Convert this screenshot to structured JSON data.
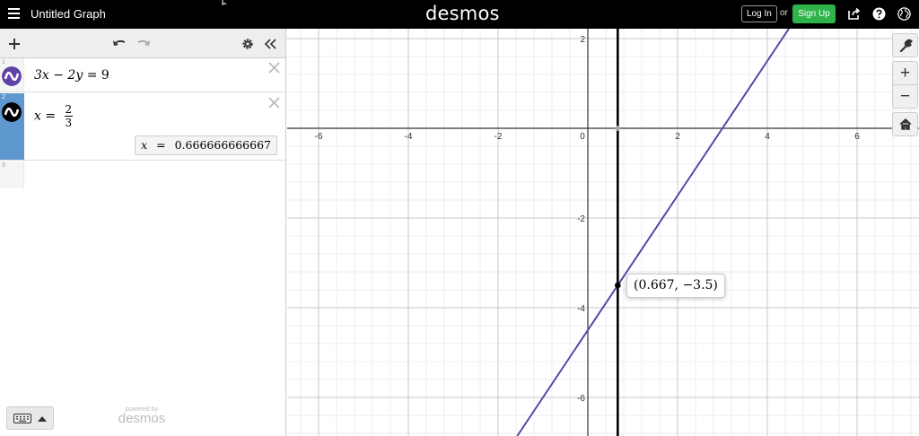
{
  "header": {
    "title": "Untitled Graph",
    "brand": "desmos",
    "login_label": "Log In",
    "or_label": "or",
    "signup_label": "Sign Up"
  },
  "expressions": [
    {
      "number": "1",
      "color": "#6042a6",
      "latex": {
        "lhs": "3x − 2y",
        "rhs": "9"
      }
    },
    {
      "number": "2",
      "color": "#000000",
      "latex": {
        "lhs": "x",
        "num": "2",
        "den": "3"
      },
      "evaluation": {
        "var": "x",
        "eq": "=",
        "value": "0.666666666667"
      }
    },
    {
      "number": "3"
    }
  ],
  "footer": {
    "powered_by": "powered by",
    "brand": "desmos"
  },
  "graph": {
    "x_ticks": [
      "-6",
      "-4",
      "-2",
      "0",
      "2",
      "4",
      "6"
    ],
    "y_ticks": [
      "2",
      "-2",
      "-4",
      "-6"
    ],
    "point_label": "(0.667, −3.5)",
    "point": {
      "x": 0.667,
      "y": -3.5
    },
    "line_color": "#6042a6",
    "vertical_color": "#000000"
  },
  "graph_controls": {
    "zoom_in": "+",
    "zoom_out": "−"
  }
}
